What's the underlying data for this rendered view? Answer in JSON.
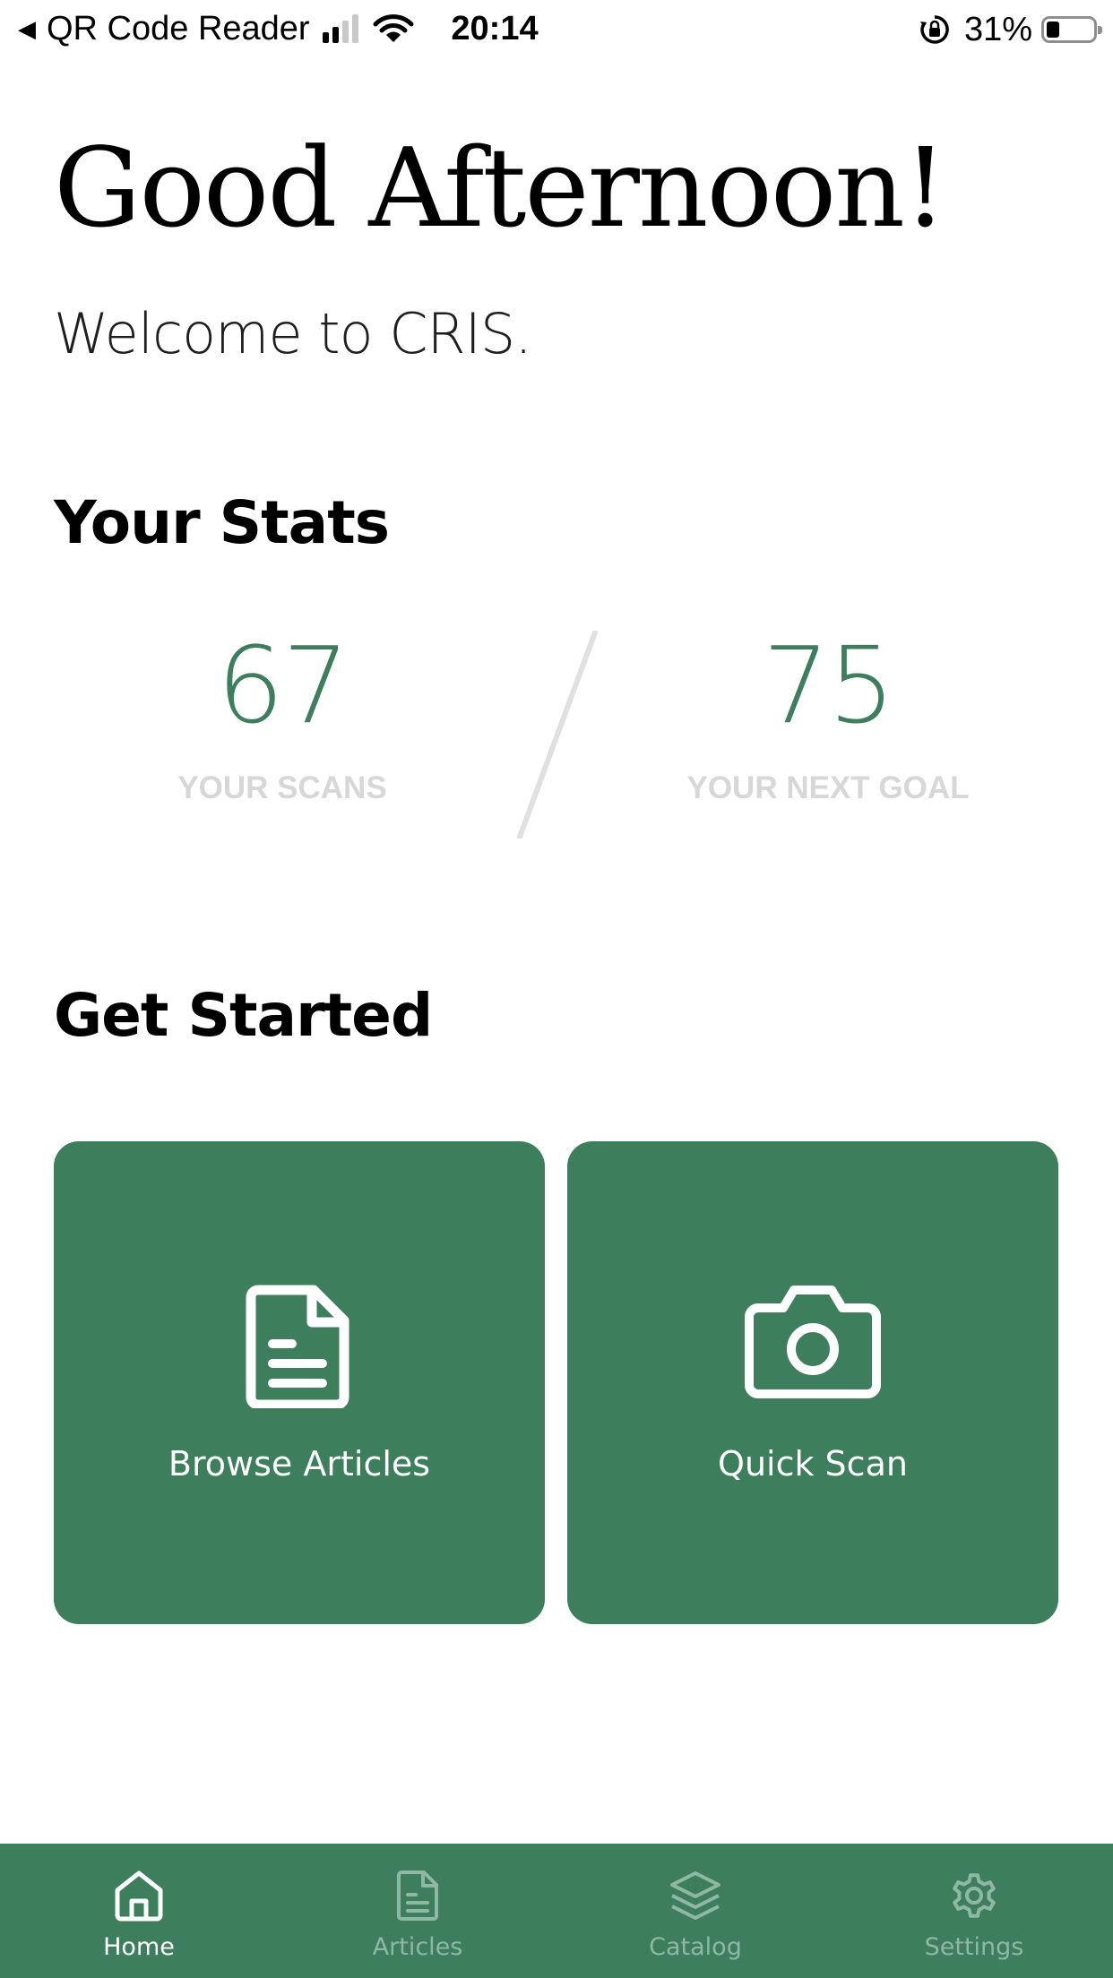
{
  "status_bar": {
    "back_app": "QR Code Reader",
    "time": "20:14",
    "battery": "31%",
    "signal_bars_active": 2,
    "signal_bars_total": 4
  },
  "header": {
    "greeting": "Good Afternoon!",
    "welcome": "Welcome to CRIS."
  },
  "stats": {
    "heading": "Your Stats",
    "scans_value": "67",
    "scans_label": "YOUR SCANS",
    "goal_value": "75",
    "goal_label": "YOUR NEXT GOAL"
  },
  "get_started": {
    "heading": "Get Started",
    "browse_label": "Browse Articles",
    "browse_icon": "document-icon",
    "scan_label": "Quick Scan",
    "scan_icon": "camera-icon"
  },
  "tab_bar": {
    "active": "Home",
    "tabs": [
      {
        "label": "Home",
        "icon": "home-icon"
      },
      {
        "label": "Articles",
        "icon": "document-icon"
      },
      {
        "label": "Catalog",
        "icon": "layers-icon"
      },
      {
        "label": "Settings",
        "icon": "gear-icon"
      }
    ]
  },
  "colors": {
    "accent": "#3d7f5c",
    "tab_inactive": "#8fb8a2",
    "stat_caption": "#d7d7d7",
    "divider": "#e0e0e0"
  }
}
